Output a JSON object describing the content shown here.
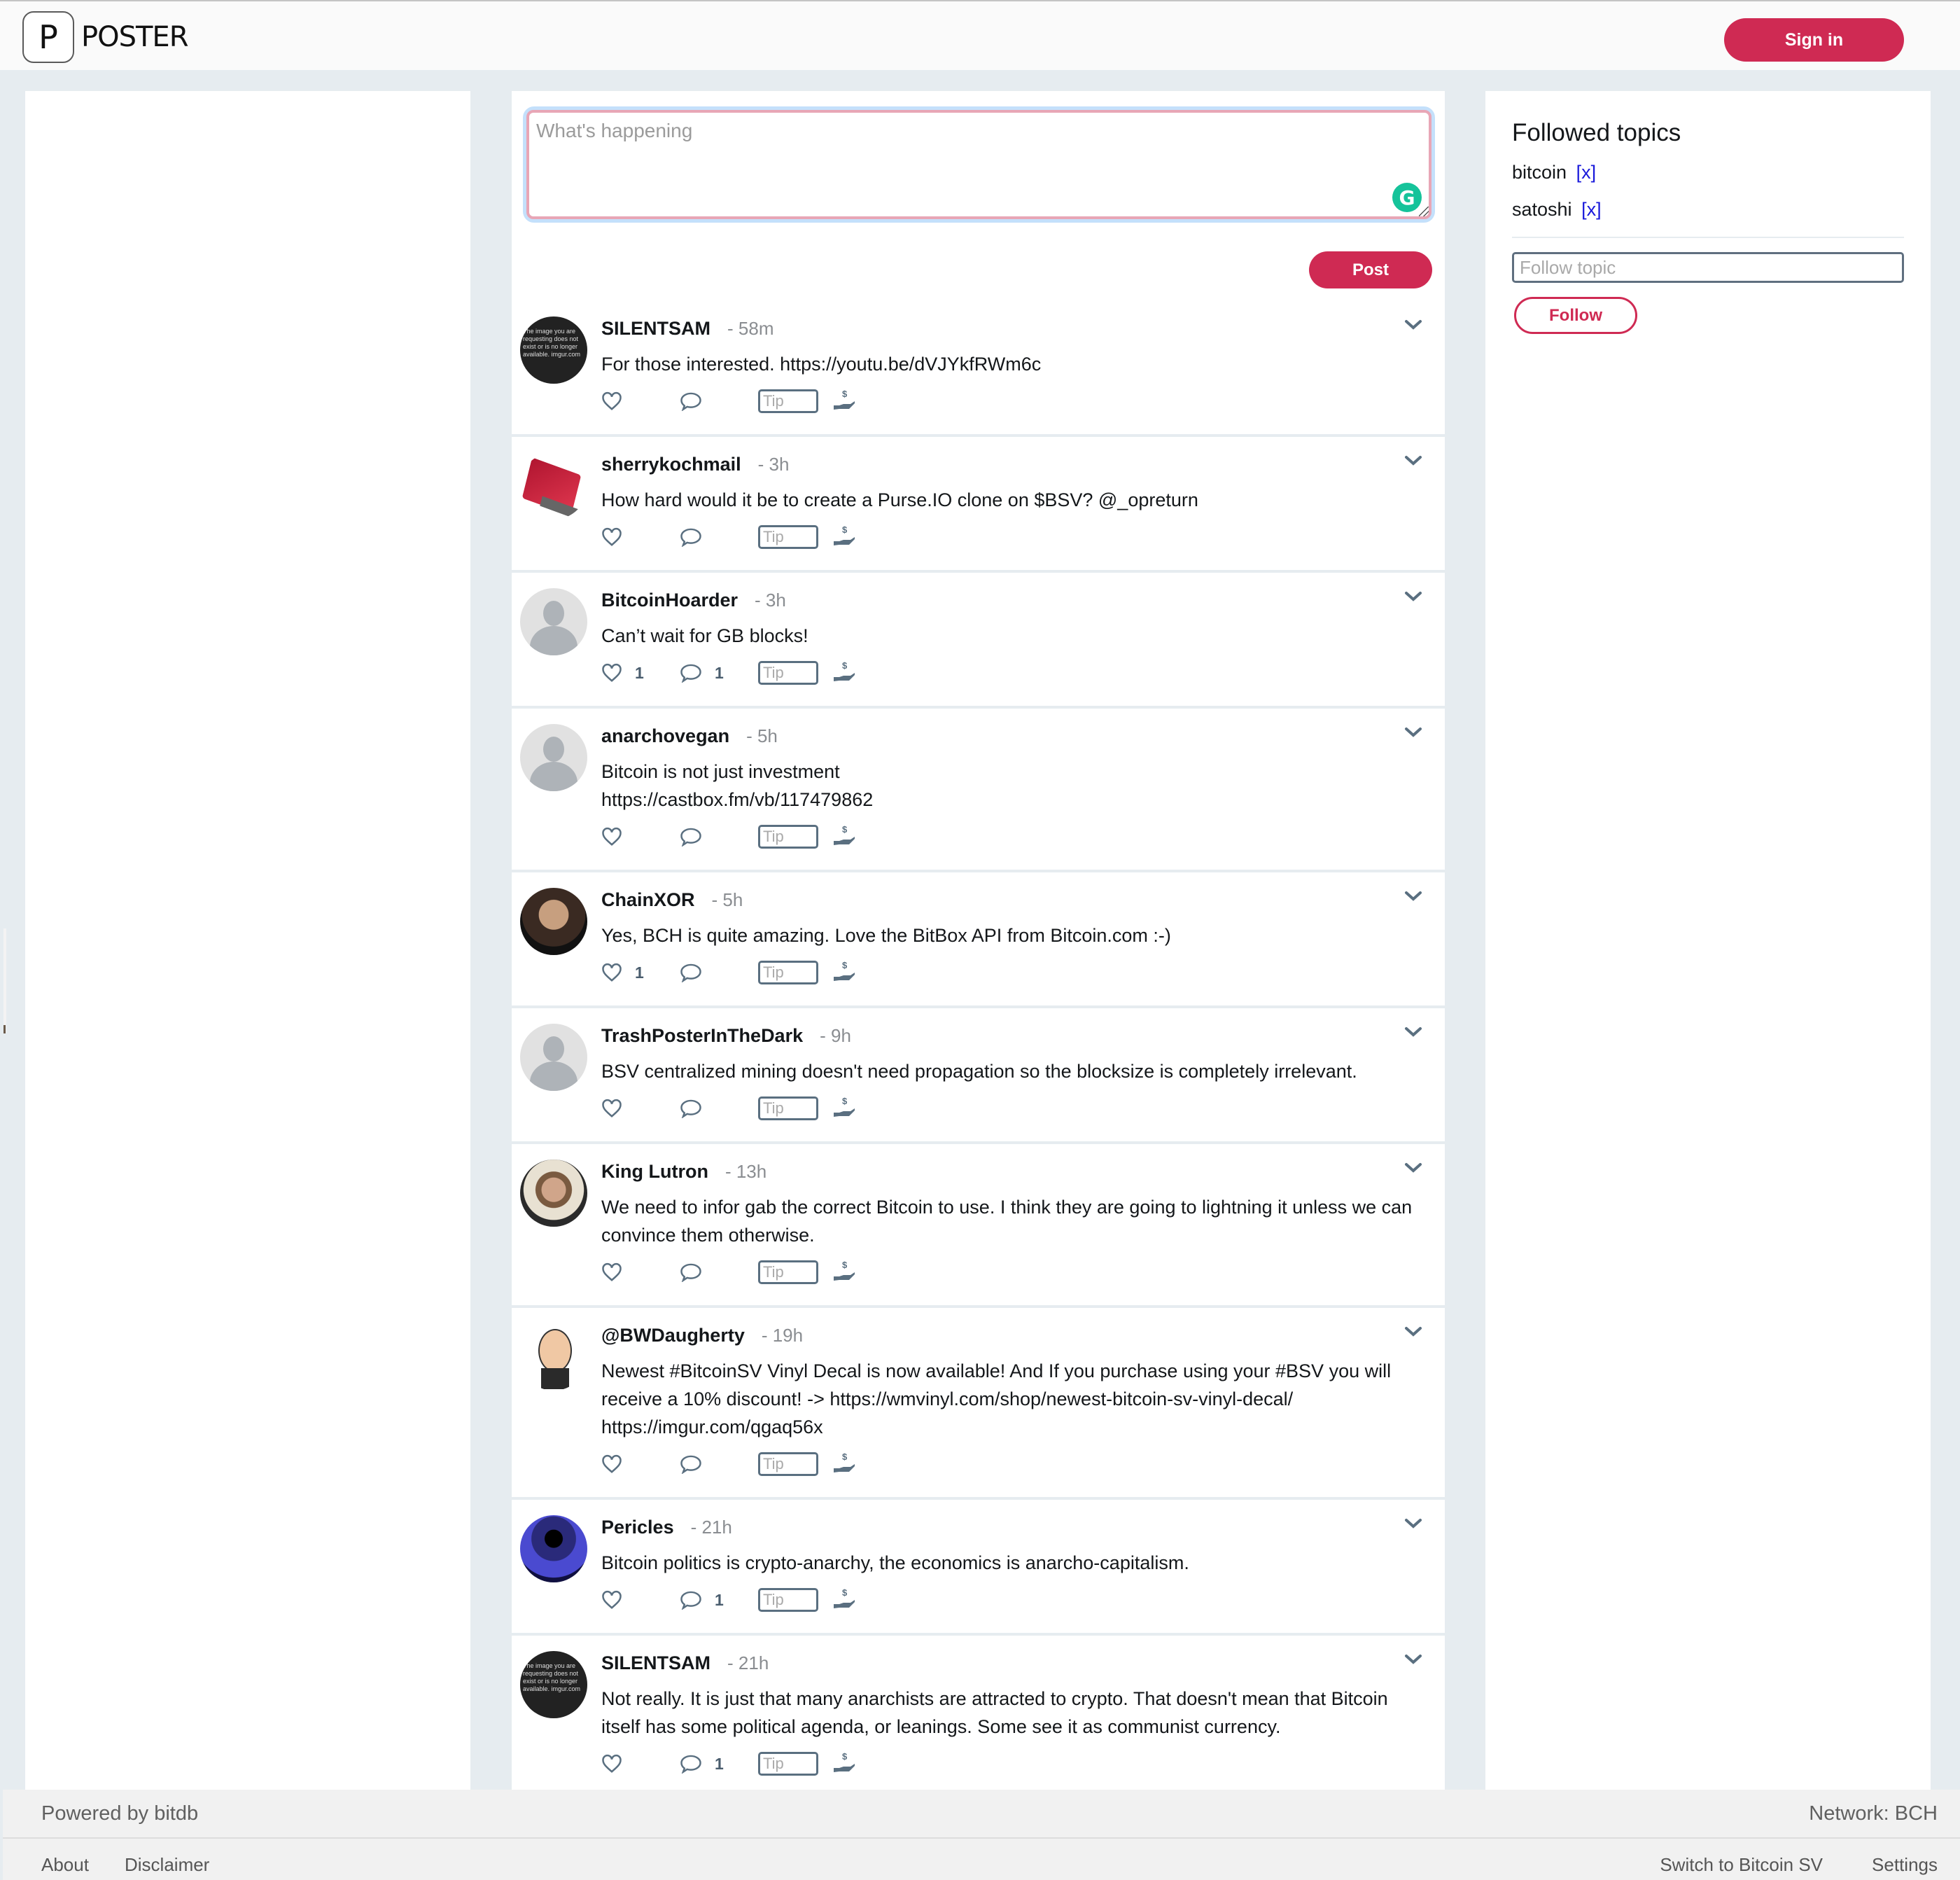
{
  "header": {
    "logo_letter": "P",
    "logo_text": "POSTER",
    "signin_label": "Sign in"
  },
  "composer": {
    "placeholder": "What's happening",
    "value": "",
    "grammarly_letter": "G",
    "post_label": "Post"
  },
  "posts": [
    {
      "author": "SILENTSAM",
      "time": "- 58m",
      "text": "For those interested.  https://youtu.be/dVJYkfRWm6c",
      "likes": "",
      "comments": "",
      "tip_placeholder": "Tip",
      "avatar": "image-unavailable"
    },
    {
      "author": "sherrykochmail",
      "time": "- 3h",
      "text": "How hard would it be to create a Purse.IO clone on $BSV? @_opreturn",
      "likes": "",
      "comments": "",
      "tip_placeholder": "Tip",
      "avatar": "red-laptop"
    },
    {
      "author": "BitcoinHoarder",
      "time": "- 3h",
      "text": "Can’t wait for GB blocks!",
      "likes": "1",
      "comments": "1",
      "tip_placeholder": "Tip",
      "avatar": "default-user"
    },
    {
      "author": "anarchovegan",
      "time": "- 5h",
      "text": "Bitcoin is not just investment\nhttps://castbox.fm/vb/117479862",
      "likes": "",
      "comments": "",
      "tip_placeholder": "Tip",
      "avatar": "default-user"
    },
    {
      "author": "ChainXOR",
      "time": "- 5h",
      "text": "Yes, BCH is quite amazing. Love the BitBox API from Bitcoin.com :-)",
      "likes": "1",
      "comments": "",
      "tip_placeholder": "Tip",
      "avatar": "portrait-quote"
    },
    {
      "author": "TrashPosterInTheDark",
      "time": "- 9h",
      "text": "BSV centralized  mining doesn't need propagation so the blocksize is completely irrelevant.",
      "likes": "",
      "comments": "",
      "tip_placeholder": "Tip",
      "avatar": "default-user"
    },
    {
      "author": "King Lutron",
      "time": "- 13h",
      "text": "We need to infor gab the correct Bitcoin to use. I think they are going to lightning it unless we can convince them otherwise.",
      "likes": "",
      "comments": "",
      "tip_placeholder": "Tip",
      "avatar": "face-photo"
    },
    {
      "author": "@BWDaugherty",
      "time": "- 19h",
      "text": "Newest #BitcoinSV Vinyl Decal is now available! And If you purchase using your #BSV you will receive a 10% discount! -> https://wmvinyl.com/shop/newest-bitcoin-sv-vinyl-decal/\nhttps://imgur.com/qgaq56x",
      "likes": "",
      "comments": "",
      "tip_placeholder": "Tip",
      "avatar": "cartoon"
    },
    {
      "author": "Pericles",
      "time": "- 21h",
      "text": "Bitcoin politics is crypto-anarchy, the economics is anarcho-capitalism.",
      "likes": "",
      "comments": "1",
      "tip_placeholder": "Tip",
      "avatar": "space"
    },
    {
      "author": "SILENTSAM",
      "time": "- 21h",
      "text": "Not really. It is just that many anarchists are attracted to crypto. That doesn't mean that Bitcoin itself has some political agenda, or leanings. Some see it as communist currency.",
      "likes": "",
      "comments": "1",
      "tip_placeholder": "Tip",
      "avatar": "image-unavailable"
    }
  ],
  "avatar_unavailable_text": "The image you are requesting does not exist or is no longer available. imgur.com",
  "sidebar_right": {
    "title": "Followed topics",
    "topics": [
      {
        "name": "bitcoin",
        "remove_label": "[x]"
      },
      {
        "name": "satoshi",
        "remove_label": "[x]"
      }
    ],
    "follow_input_placeholder": "Follow topic",
    "follow_input_value": "",
    "follow_label": "Follow"
  },
  "footer": {
    "powered_by": "Powered by bitdb",
    "network": "Network: BCH",
    "links_left": [
      "About",
      "Disclaimer"
    ],
    "links_right": [
      "Switch to Bitcoin SV",
      "Settings"
    ]
  },
  "colors": {
    "accent": "#cf2a53",
    "page_bg": "#e6ecf0",
    "icon": "#5a6f80",
    "link_x": "#1a1adb"
  }
}
